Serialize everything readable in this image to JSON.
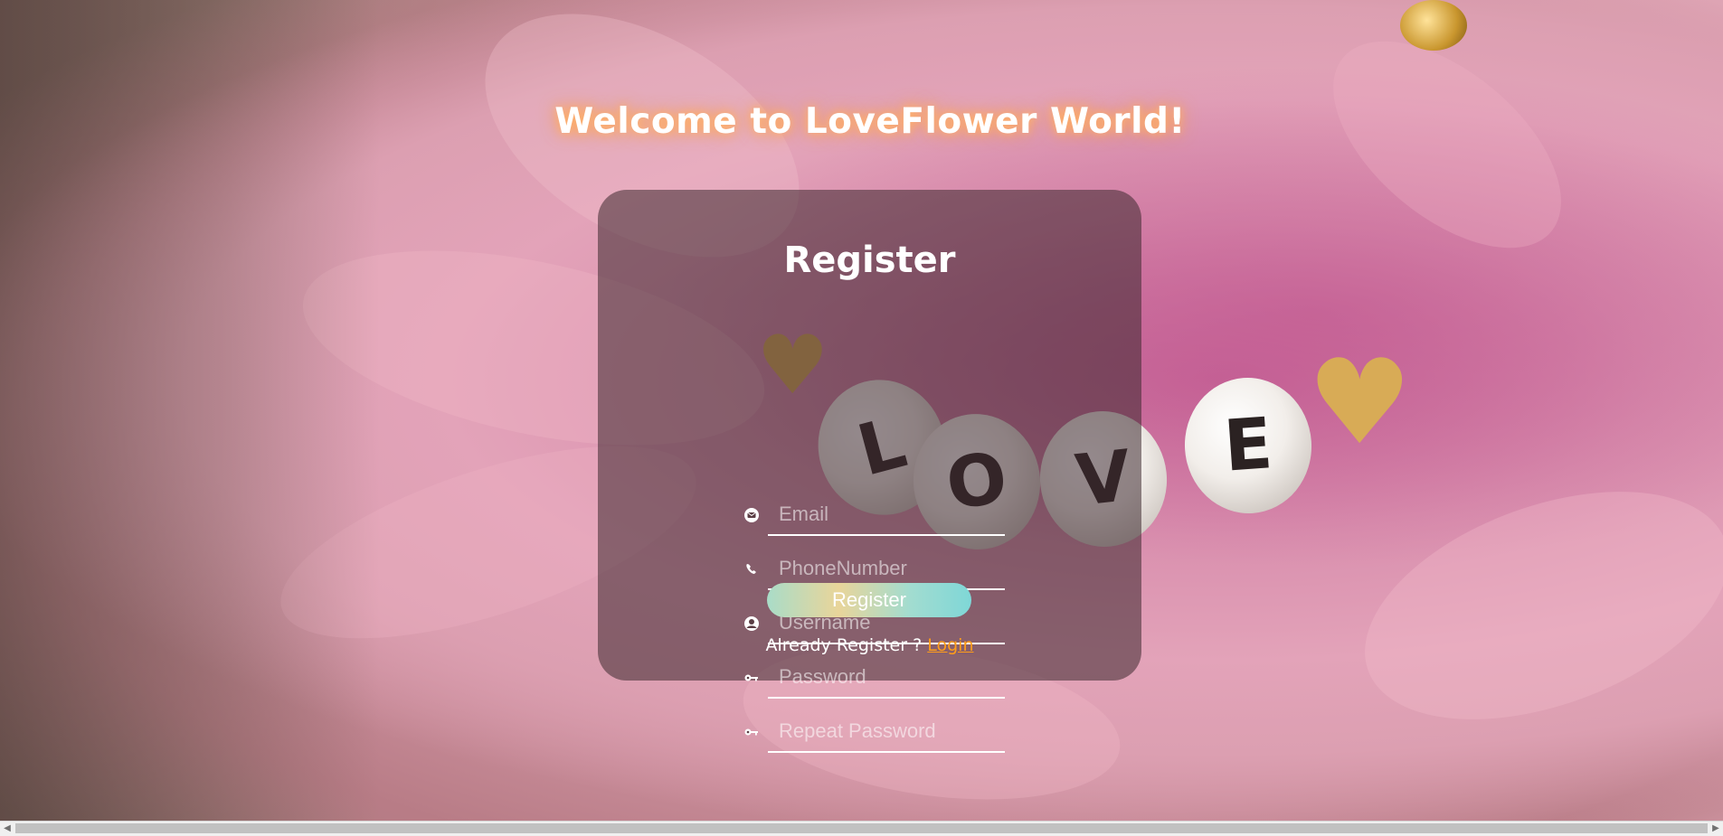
{
  "welcome_title": "Welcome to LoveFlower World!",
  "form": {
    "title": "Register",
    "fields": [
      {
        "icon": "mail-icon",
        "placeholder": "Email"
      },
      {
        "icon": "phone-icon",
        "placeholder": "PhoneNumber"
      },
      {
        "icon": "user-icon",
        "placeholder": "Username"
      },
      {
        "icon": "key-icon",
        "placeholder": "Password"
      },
      {
        "icon": "key-icon",
        "placeholder": "Repeat Password"
      }
    ],
    "submit_label": "Register",
    "login_prompt": "Already Register ?",
    "login_link": "Login"
  },
  "background_beads": [
    "L",
    "O",
    "V",
    "E"
  ],
  "colors": {
    "accent_link": "#ff9d1a",
    "title_glow": "#ffb36b",
    "card_bg": "rgba(60, 40, 45, 0.55)"
  }
}
